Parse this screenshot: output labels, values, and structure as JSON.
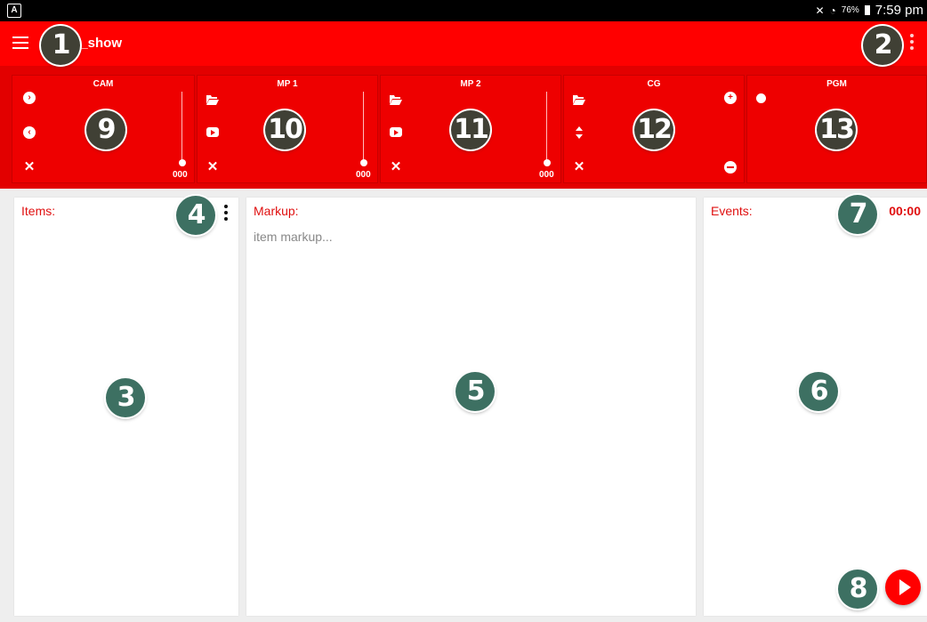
{
  "status_bar": {
    "app_icon": "A",
    "icons": [
      "vibrate-mute-icon",
      "wifi-icon",
      "battery-icon"
    ],
    "battery": "76%",
    "time": "7:59 pm"
  },
  "toolbar": {
    "title": "first_show",
    "menu_icon": "hamburger-menu-icon",
    "overflow_icon": "overflow-menu-icon"
  },
  "decks": [
    {
      "label": "CAM",
      "slider_value": "000"
    },
    {
      "label": "MP 1",
      "slider_value": "000"
    },
    {
      "label": "MP 2",
      "slider_value": "000"
    },
    {
      "label": "CG"
    },
    {
      "label": "PGM"
    }
  ],
  "panels": {
    "items": {
      "label": "Items:"
    },
    "markup": {
      "label": "Markup:",
      "placeholder": "item markup..."
    },
    "events": {
      "label": "Events:",
      "timer": "00:00"
    }
  },
  "callouts": [
    "1",
    "2",
    "3",
    "4",
    "5",
    "6",
    "7",
    "8",
    "9",
    "10",
    "11",
    "12",
    "13"
  ],
  "colors": {
    "primary": "#ff0000",
    "deck": "#ee0000",
    "accent_text": "#e01010",
    "callout_dark": "#404035",
    "callout_teal": "#3d7062"
  }
}
